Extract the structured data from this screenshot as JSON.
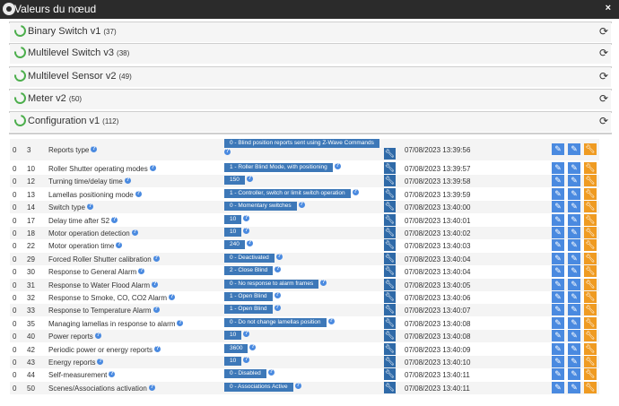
{
  "window": {
    "title": "Valeurs du nœud",
    "close_icon": "×"
  },
  "sections": [
    {
      "title": "Binary Switch v1",
      "count": "(37)"
    },
    {
      "title": "Multilevel Switch v3",
      "count": "(38)"
    },
    {
      "title": "Multilevel Sensor v2",
      "count": "(49)"
    },
    {
      "title": "Meter v2",
      "count": "(50)"
    },
    {
      "title": "Configuration v1",
      "count": "(112)"
    }
  ],
  "icons": {
    "section": "circle-notch-icon",
    "refresh": "refresh-icon",
    "help": "question-icon",
    "config": "wrench-icon",
    "edit": "pencil-icon",
    "edit2": "pencil-icon",
    "action": "wrench-icon"
  },
  "colors": {
    "titlebar": "#2b2b2b",
    "section_icon": "#4cae4c",
    "value_badge": "#3d78b8",
    "edit_button": "#4a8ae0",
    "action_button": "#ef9b22"
  },
  "config_rows": [
    {
      "instance": "0",
      "index": "3",
      "name": "Reports type",
      "value": "0 - Blind position reports sent using Z-Wave Commands",
      "date": "07/08/2023 13:39:56"
    },
    {
      "instance": "0",
      "index": "10",
      "name": "Roller Shutter operating modes",
      "value": "1 - Roller Blind Mode, with positioning",
      "date": "07/08/2023 13:39:57"
    },
    {
      "instance": "0",
      "index": "12",
      "name": "Turning time/delay time",
      "value": "150",
      "date": "07/08/2023 13:39:58"
    },
    {
      "instance": "0",
      "index": "13",
      "name": "Lamellas positioning mode",
      "value": "1 - Controller, switch or limit switch operation",
      "date": "07/08/2023 13:39:59"
    },
    {
      "instance": "0",
      "index": "14",
      "name": "Switch type",
      "value": "0 - Momentary switches",
      "date": "07/08/2023 13:40:00"
    },
    {
      "instance": "0",
      "index": "17",
      "name": "Delay time after S2",
      "value": "10",
      "date": "07/08/2023 13:40:01"
    },
    {
      "instance": "0",
      "index": "18",
      "name": "Motor operation detection",
      "value": "10",
      "date": "07/08/2023 13:40:02"
    },
    {
      "instance": "0",
      "index": "22",
      "name": "Motor operation time",
      "value": "240",
      "date": "07/08/2023 13:40:03"
    },
    {
      "instance": "0",
      "index": "29",
      "name": "Forced Roller Shutter calibration",
      "value": "0 - Deactivated",
      "date": "07/08/2023 13:40:04"
    },
    {
      "instance": "0",
      "index": "30",
      "name": "Response to General Alarm",
      "value": "2 - Close Blind",
      "date": "07/08/2023 13:40:04"
    },
    {
      "instance": "0",
      "index": "31",
      "name": "Response to Water Flood Alarm",
      "value": "0 - No response to alarm frames",
      "date": "07/08/2023 13:40:05"
    },
    {
      "instance": "0",
      "index": "32",
      "name": "Response to Smoke, CO, CO2 Alarm",
      "value": "1 - Open Blind",
      "date": "07/08/2023 13:40:06"
    },
    {
      "instance": "0",
      "index": "33",
      "name": "Response to Temperature Alarm",
      "value": "1 - Open Blind",
      "date": "07/08/2023 13:40:07"
    },
    {
      "instance": "0",
      "index": "35",
      "name": "Managing lamellas in response to alarm",
      "value": "0 - Do not change lamellas position",
      "date": "07/08/2023 13:40:08"
    },
    {
      "instance": "0",
      "index": "40",
      "name": "Power reports",
      "value": "10",
      "date": "07/08/2023 13:40:08"
    },
    {
      "instance": "0",
      "index": "42",
      "name": "Periodic power or energy reports",
      "value": "3600",
      "date": "07/08/2023 13:40:09"
    },
    {
      "instance": "0",
      "index": "43",
      "name": "Energy reports",
      "value": "10",
      "date": "07/08/2023 13:40:10"
    },
    {
      "instance": "0",
      "index": "44",
      "name": "Self-measurement",
      "value": "0 - Disabled",
      "date": "07/08/2023 13:40:11"
    },
    {
      "instance": "0",
      "index": "50",
      "name": "Scenes/Associations activation",
      "value": "0 - Associations Active",
      "date": "07/08/2023 13:40:11"
    }
  ]
}
